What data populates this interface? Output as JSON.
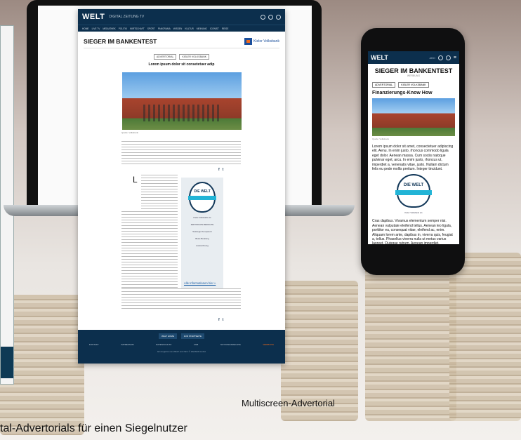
{
  "captions": {
    "multiscreen": "Multiscreen-Advertorial",
    "bottom": "tal-Advertorials für einen Siegelnutzer"
  },
  "desktop": {
    "brand": "WELT",
    "nav_text": "DIGITAL  ZEITUNG  TV",
    "menu_items": [
      "HOME",
      "LIVE TV",
      "MEDIATHEK",
      "POLITIK",
      "WIRTSCHAFT",
      "SPORT",
      "PANORAMA",
      "WISSEN",
      "KULTUR",
      "MEINUNG",
      "ICONIST",
      "REISE"
    ],
    "page_title": "SIEGER IM BANKENTEST",
    "partner_logo": "Kieler Volksbank",
    "tags": [
      "ADVERTORIAL",
      "KIELER VOLKSBANK"
    ],
    "headline": "Lorem ipsum dolor sit consetetuer adip",
    "photo_caption": "Quelle: Volksbank",
    "dropcap": "L",
    "seal": {
      "title": "DIE WELT",
      "ribbon": "Kieler Volksbank eG",
      "lines": [
        "ZERTIFIKATE BERICHTE",
        "Testsieger Kompetenz",
        "Beste Beratung",
        "Auszeichnung"
      ]
    },
    "more_link": "Alle Informationen hier »",
    "footer_buttons": [
      "WELT HOME",
      "ZUR STARTSEITE"
    ],
    "footer_links": [
      "KONTAKT",
      "IMPRESSUM",
      "DATENSCHUTZ",
      "AGB",
      "NUTZUNGSRECHTE",
      "WERBUNG"
    ],
    "footer_copy": "Ein Angebot von WELT und N24. © WeltN24 GmbH"
  },
  "mobile": {
    "brand": "WELT",
    "nav_text": "ABO",
    "page_title": "SIEGER IM BANKENTEST",
    "subtitle": "WERBUNG",
    "tags": [
      "ADVERTORIAL",
      "KIELER VOLKSBANK"
    ],
    "headline": "Finanzierungs-Know How",
    "photo_caption": "Quelle: Volksbank",
    "paragraph1": "Lorem ipsum dolor sit amet, consectetuer adipiscing elit. Aenu. In enim justo, rhoncus commodo ligula eget dolor. Aenean massa. Cum sociis natoque pulvinar eget, arcu. In enim justo, rhoncus ut, imperdiet a, venenatis vitae, justo. Nullam dictum felis eu pede mollis pretium. Integer tincidunt.",
    "seal_title": "DIE WELT",
    "seal_ribbon": "Kieler Volksbank eG",
    "paragraph2": "Cras dapibus. Vivamus elementum semper nisi. Aenean vulputate eleifend tellus. Aenean leo ligula, porttitor eu, consequat vitae, eleifend ac, enim. Aliquam lorem ante, dapibus in, viverra quis, feugiat a, tellus. Phasellus viverra nulla ut metus varius laoreet. Quisque rutrum. Aenean imperdiet."
  },
  "colors": {
    "brand_navy": "#0c2f4d",
    "seal_cyan": "#22b4d6",
    "vb_blue": "#1b4f9c",
    "vb_orange": "#f26a1b"
  }
}
